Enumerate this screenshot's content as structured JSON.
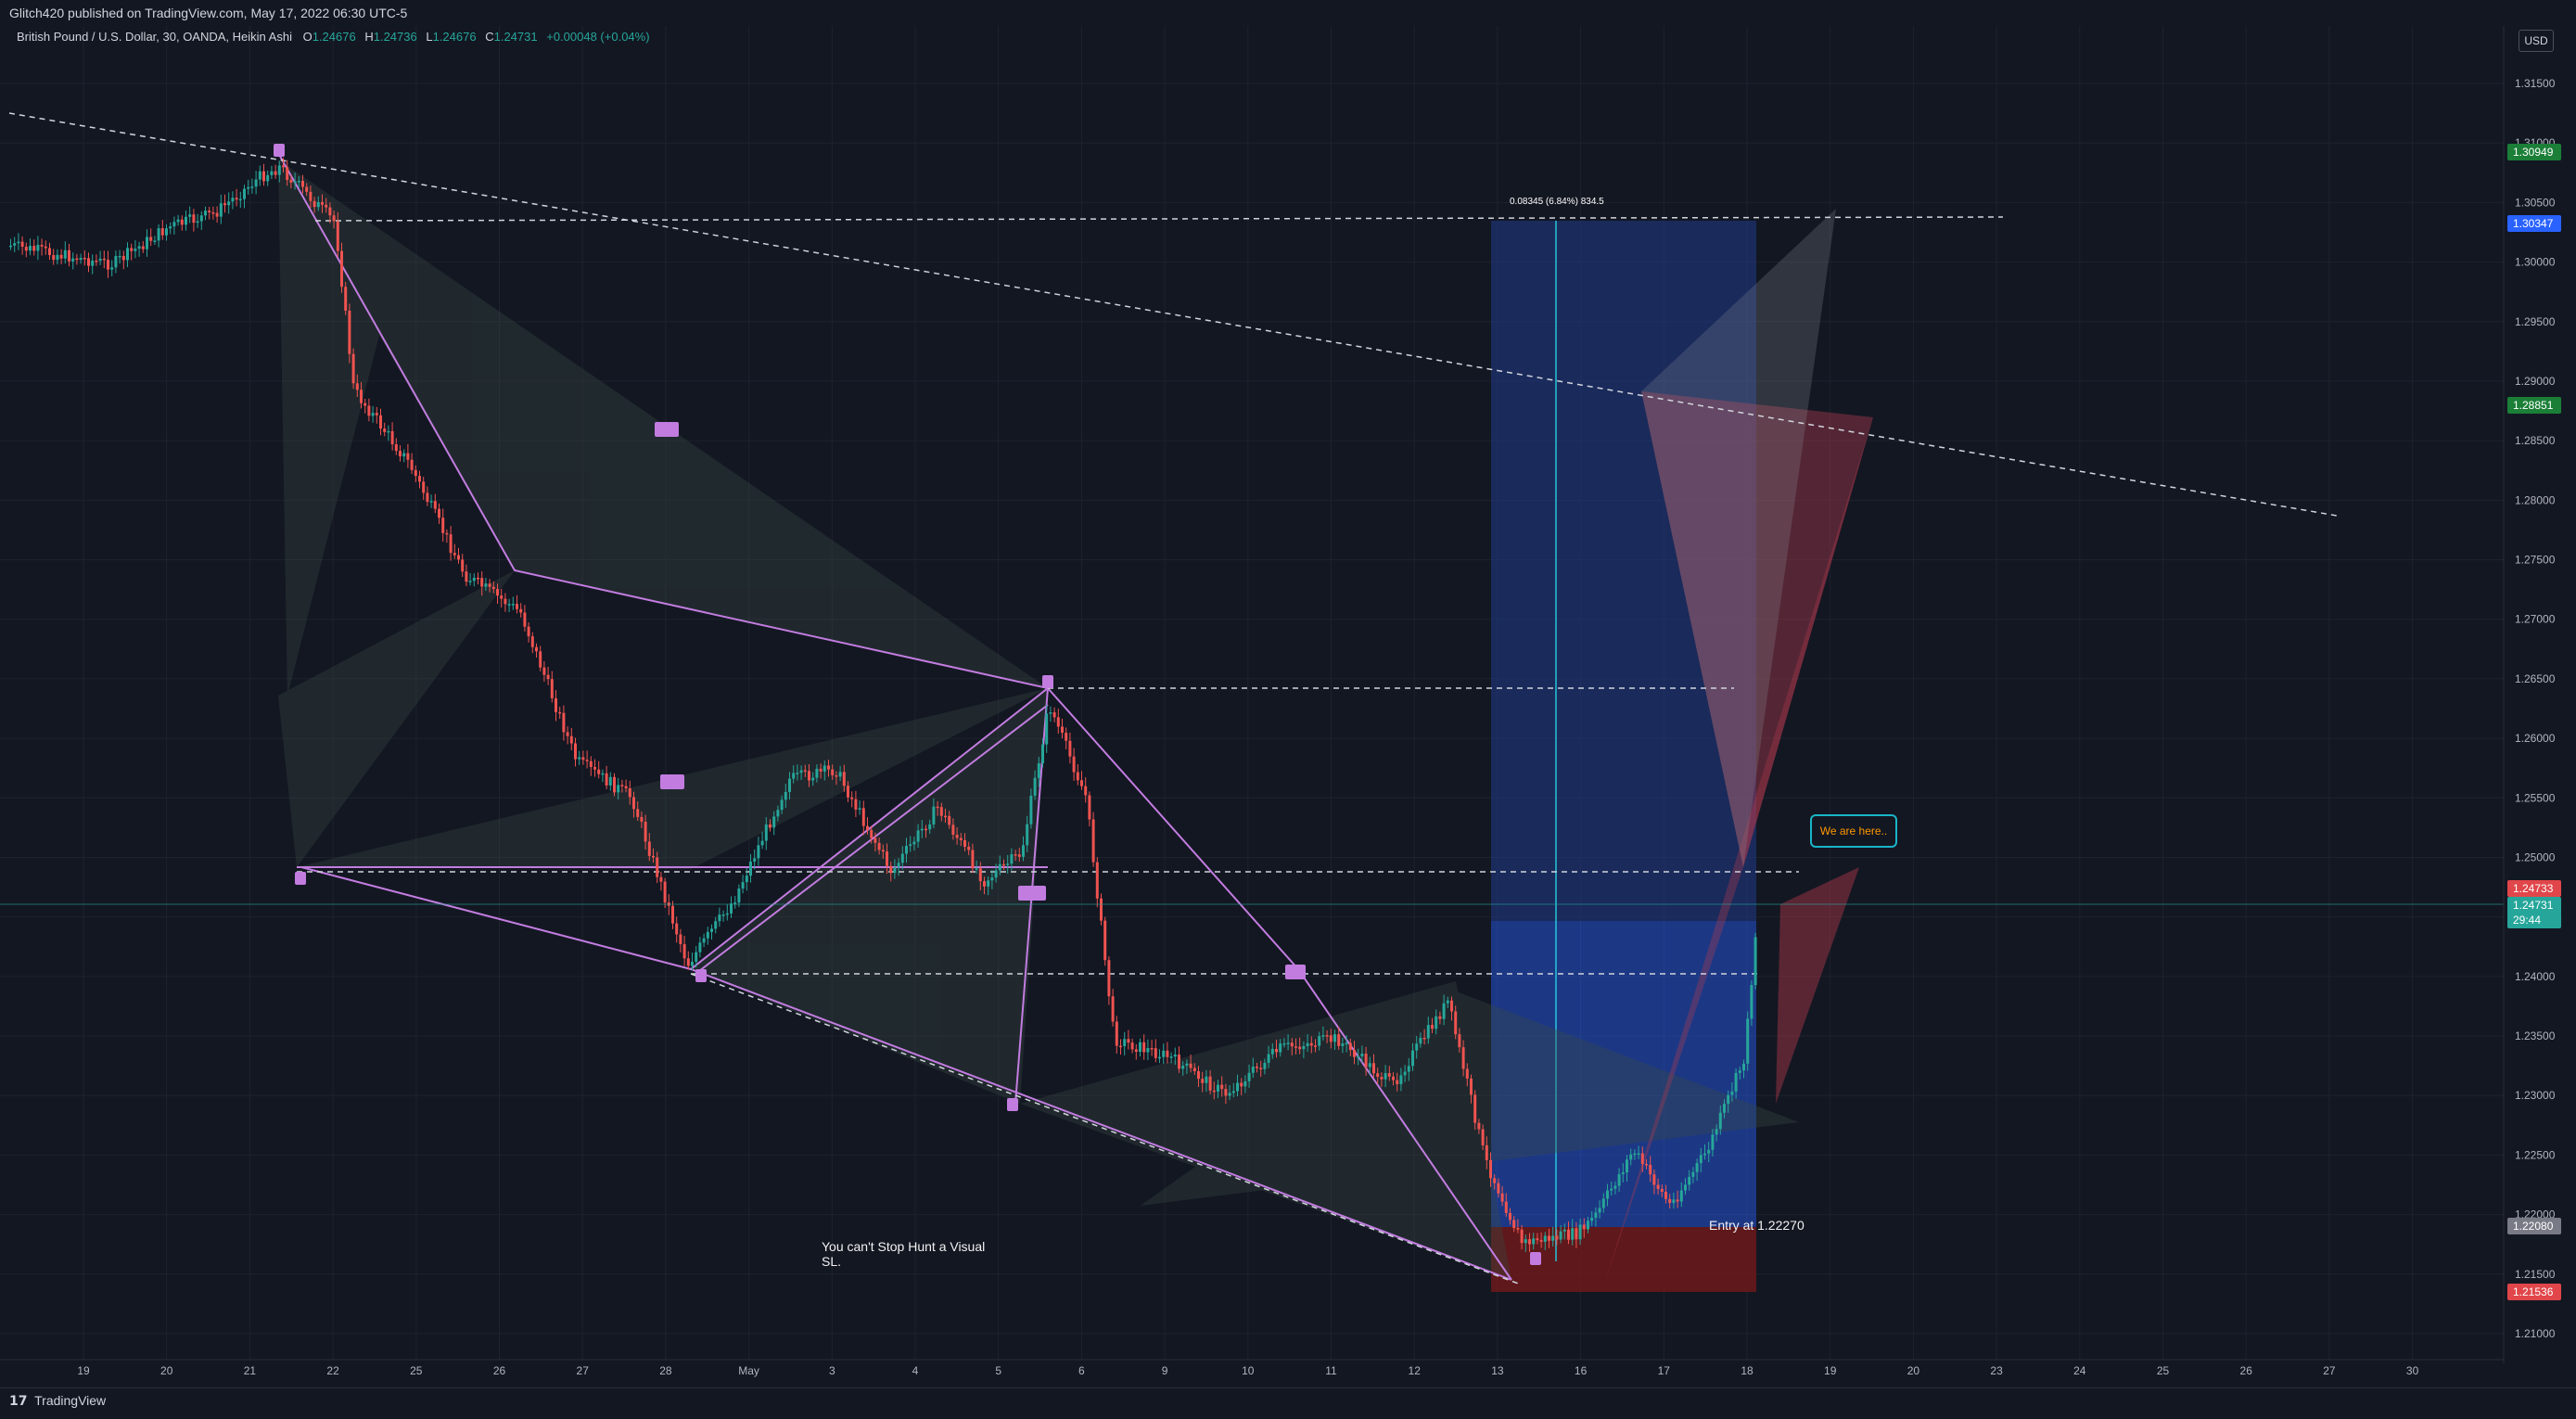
{
  "header": {
    "published": "Glitch420 published on TradingView.com, May 17, 2022 06:30 UTC-5",
    "symbol": "British Pound / U.S. Dollar, 30, OANDA, Heikin Ashi",
    "o_label": "O",
    "o_value": "1.24676",
    "h_label": "H",
    "h_value": "1.24736",
    "l_label": "L",
    "l_value": "1.24676",
    "c_label": "C",
    "c_value": "1.24731",
    "change": "+0.00048 (+0.04%)"
  },
  "currency": "USD",
  "price_axis": {
    "ticks": [
      "1.31500",
      "1.31000",
      "1.30500",
      "1.30000",
      "1.29500",
      "1.29000",
      "1.28500",
      "1.28000",
      "1.27500",
      "1.27000",
      "1.26500",
      "1.26000",
      "1.25500",
      "1.25000",
      "1.24500",
      "1.24000",
      "1.23500",
      "1.23000",
      "1.22500",
      "1.22000",
      "1.21500",
      "1.21000"
    ],
    "badges": [
      {
        "text": "1.30949",
        "color": "#1b7f37"
      },
      {
        "text": "1.30347",
        "color": "#2962ff"
      },
      {
        "text": "1.28851",
        "color": "#1b7f37"
      },
      {
        "text": "1.24733",
        "color": "#e0464a"
      },
      {
        "text": "1.24731",
        "color": "#26a69a"
      },
      {
        "text": "29:44",
        "color": "#26a69a"
      },
      {
        "text": "1.22080",
        "color": "#787b86"
      },
      {
        "text": "1.21536",
        "color": "#e0464a"
      }
    ]
  },
  "time_axis": {
    "labels": [
      "19",
      "20",
      "21",
      "22",
      "25",
      "26",
      "27",
      "28",
      "May",
      "3",
      "4",
      "5",
      "6",
      "9",
      "10",
      "11",
      "12",
      "13",
      "16",
      "17",
      "18",
      "19",
      "20",
      "23",
      "24",
      "25",
      "26",
      "27",
      "30"
    ]
  },
  "annotations": {
    "measure_label": "0.08345 (6.84%) 834.5",
    "entry_text": "Entry at 1.22270",
    "visual_sl_line1": "You can't Stop Hunt a Visual",
    "visual_sl_line2": "SL.",
    "callout": "We are here.."
  },
  "footer": {
    "logo_mark": "17",
    "logo_text": "TradingView"
  },
  "colors": {
    "background": "#131722",
    "bull": "#26a69a",
    "bear": "#ef5350",
    "pattern": "#d36fe8",
    "target_zone": "#2962ff",
    "stop_zone": "#b71c1c"
  }
}
